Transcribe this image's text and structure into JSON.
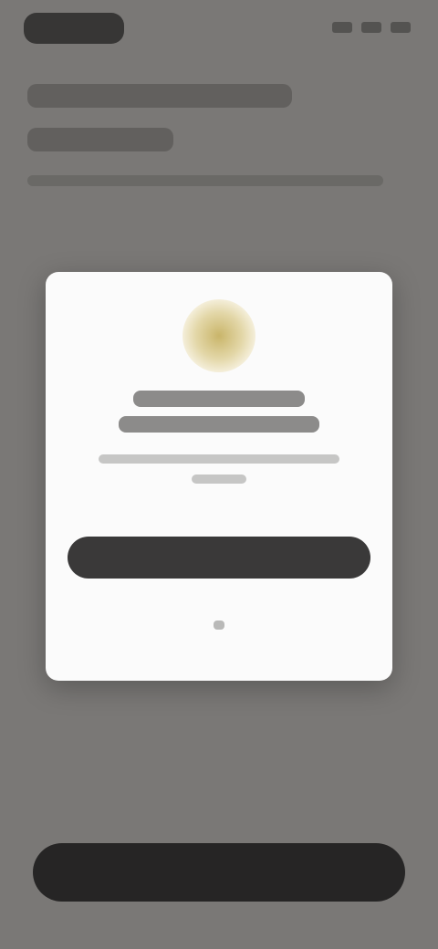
{
  "colors": {
    "backdrop": "#7a7876",
    "modal_background": "#fbfbfb",
    "primary_button": "#3a3939",
    "bottom_button": "#262525",
    "icon_accent": "#c9b56a"
  },
  "icons": {
    "modal_icon": "badge-icon"
  }
}
